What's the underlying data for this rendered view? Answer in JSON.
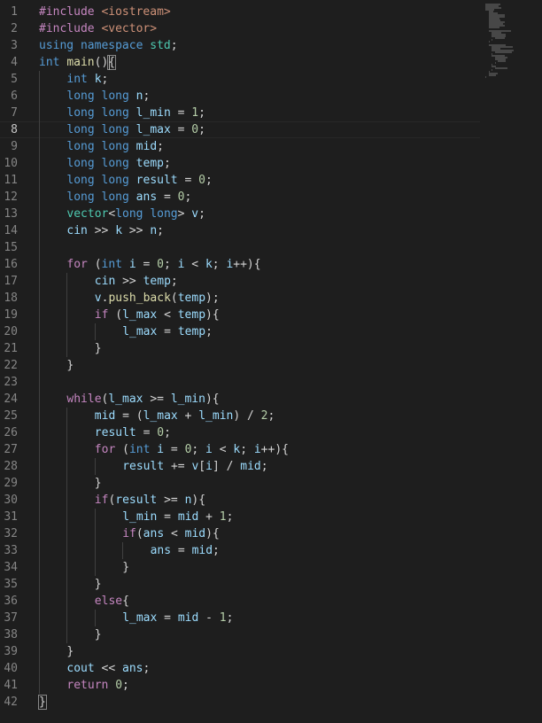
{
  "editor": {
    "current_line": 8,
    "lines": [
      {
        "n": "1",
        "indent": 0,
        "tokens": [
          [
            "#include",
            "pre"
          ],
          [
            " ",
            "punc"
          ],
          [
            "<iostream>",
            "str"
          ]
        ]
      },
      {
        "n": "2",
        "indent": 0,
        "tokens": [
          [
            "#include",
            "pre"
          ],
          [
            " ",
            "punc"
          ],
          [
            "<vector>",
            "str"
          ]
        ]
      },
      {
        "n": "3",
        "indent": 0,
        "tokens": [
          [
            "using",
            "kw"
          ],
          [
            " ",
            "punc"
          ],
          [
            "namespace",
            "kw"
          ],
          [
            " ",
            "punc"
          ],
          [
            "std",
            "type"
          ],
          [
            ";",
            "punc"
          ]
        ]
      },
      {
        "n": "4",
        "indent": 0,
        "tokens": [
          [
            "int",
            "kw"
          ],
          [
            " ",
            "punc"
          ],
          [
            "main",
            "fn"
          ],
          [
            "()",
            "punc"
          ],
          [
            "{",
            "bracket"
          ]
        ]
      },
      {
        "n": "5",
        "indent": 1,
        "tokens": [
          [
            "int",
            "kw"
          ],
          [
            " ",
            "punc"
          ],
          [
            "k",
            "var"
          ],
          [
            ";",
            "punc"
          ]
        ]
      },
      {
        "n": "6",
        "indent": 1,
        "tokens": [
          [
            "long",
            "kw"
          ],
          [
            " ",
            "punc"
          ],
          [
            "long",
            "kw"
          ],
          [
            " ",
            "punc"
          ],
          [
            "n",
            "var"
          ],
          [
            ";",
            "punc"
          ]
        ]
      },
      {
        "n": "7",
        "indent": 1,
        "tokens": [
          [
            "long",
            "kw"
          ],
          [
            " ",
            "punc"
          ],
          [
            "long",
            "kw"
          ],
          [
            " ",
            "punc"
          ],
          [
            "l_min",
            "var"
          ],
          [
            " = ",
            "punc"
          ],
          [
            "1",
            "num"
          ],
          [
            ";",
            "punc"
          ]
        ]
      },
      {
        "n": "8",
        "indent": 1,
        "tokens": [
          [
            "long",
            "kw"
          ],
          [
            " ",
            "punc"
          ],
          [
            "long",
            "kw"
          ],
          [
            " ",
            "punc"
          ],
          [
            "l_max",
            "var"
          ],
          [
            " = ",
            "punc"
          ],
          [
            "0",
            "num"
          ],
          [
            ";",
            "punc"
          ]
        ]
      },
      {
        "n": "9",
        "indent": 1,
        "tokens": [
          [
            "long",
            "kw"
          ],
          [
            " ",
            "punc"
          ],
          [
            "long",
            "kw"
          ],
          [
            " ",
            "punc"
          ],
          [
            "mid",
            "var"
          ],
          [
            ";",
            "punc"
          ]
        ]
      },
      {
        "n": "10",
        "indent": 1,
        "tokens": [
          [
            "long",
            "kw"
          ],
          [
            " ",
            "punc"
          ],
          [
            "long",
            "kw"
          ],
          [
            " ",
            "punc"
          ],
          [
            "temp",
            "var"
          ],
          [
            ";",
            "punc"
          ]
        ]
      },
      {
        "n": "11",
        "indent": 1,
        "tokens": [
          [
            "long",
            "kw"
          ],
          [
            " ",
            "punc"
          ],
          [
            "long",
            "kw"
          ],
          [
            " ",
            "punc"
          ],
          [
            "result",
            "var"
          ],
          [
            " = ",
            "punc"
          ],
          [
            "0",
            "num"
          ],
          [
            ";",
            "punc"
          ]
        ]
      },
      {
        "n": "12",
        "indent": 1,
        "tokens": [
          [
            "long",
            "kw"
          ],
          [
            " ",
            "punc"
          ],
          [
            "long",
            "kw"
          ],
          [
            " ",
            "punc"
          ],
          [
            "ans",
            "var"
          ],
          [
            " = ",
            "punc"
          ],
          [
            "0",
            "num"
          ],
          [
            ";",
            "punc"
          ]
        ]
      },
      {
        "n": "13",
        "indent": 1,
        "tokens": [
          [
            "vector",
            "type"
          ],
          [
            "<",
            "punc"
          ],
          [
            "long",
            "kw"
          ],
          [
            " ",
            "punc"
          ],
          [
            "long",
            "kw"
          ],
          [
            "> ",
            "punc"
          ],
          [
            "v",
            "var"
          ],
          [
            ";",
            "punc"
          ]
        ]
      },
      {
        "n": "14",
        "indent": 1,
        "tokens": [
          [
            "cin",
            "var"
          ],
          [
            " >> ",
            "punc"
          ],
          [
            "k",
            "var"
          ],
          [
            " >> ",
            "punc"
          ],
          [
            "n",
            "var"
          ],
          [
            ";",
            "punc"
          ]
        ]
      },
      {
        "n": "15",
        "indent": 1,
        "tokens": []
      },
      {
        "n": "16",
        "indent": 1,
        "tokens": [
          [
            "for",
            "ctrl"
          ],
          [
            " (",
            "punc"
          ],
          [
            "int",
            "kw"
          ],
          [
            " ",
            "punc"
          ],
          [
            "i",
            "var"
          ],
          [
            " = ",
            "punc"
          ],
          [
            "0",
            "num"
          ],
          [
            "; ",
            "punc"
          ],
          [
            "i",
            "var"
          ],
          [
            " < ",
            "punc"
          ],
          [
            "k",
            "var"
          ],
          [
            "; ",
            "punc"
          ],
          [
            "i",
            "var"
          ],
          [
            "++){",
            "punc"
          ]
        ]
      },
      {
        "n": "17",
        "indent": 2,
        "tokens": [
          [
            "cin",
            "var"
          ],
          [
            " >> ",
            "punc"
          ],
          [
            "temp",
            "var"
          ],
          [
            ";",
            "punc"
          ]
        ]
      },
      {
        "n": "18",
        "indent": 2,
        "tokens": [
          [
            "v",
            "var"
          ],
          [
            ".",
            "punc"
          ],
          [
            "push_back",
            "fn"
          ],
          [
            "(",
            "punc"
          ],
          [
            "temp",
            "var"
          ],
          [
            ");",
            "punc"
          ]
        ]
      },
      {
        "n": "19",
        "indent": 2,
        "tokens": [
          [
            "if",
            "ctrl"
          ],
          [
            " (",
            "punc"
          ],
          [
            "l_max",
            "var"
          ],
          [
            " < ",
            "punc"
          ],
          [
            "temp",
            "var"
          ],
          [
            "){",
            "punc"
          ]
        ]
      },
      {
        "n": "20",
        "indent": 3,
        "tokens": [
          [
            "l_max",
            "var"
          ],
          [
            " = ",
            "punc"
          ],
          [
            "temp",
            "var"
          ],
          [
            ";",
            "punc"
          ]
        ]
      },
      {
        "n": "21",
        "indent": 2,
        "tokens": [
          [
            "}",
            "punc"
          ]
        ]
      },
      {
        "n": "22",
        "indent": 1,
        "tokens": [
          [
            "}",
            "punc"
          ]
        ]
      },
      {
        "n": "23",
        "indent": 1,
        "tokens": []
      },
      {
        "n": "24",
        "indent": 1,
        "tokens": [
          [
            "while",
            "ctrl"
          ],
          [
            "(",
            "punc"
          ],
          [
            "l_max",
            "var"
          ],
          [
            " >= ",
            "punc"
          ],
          [
            "l_min",
            "var"
          ],
          [
            "){",
            "punc"
          ]
        ]
      },
      {
        "n": "25",
        "indent": 2,
        "tokens": [
          [
            "mid",
            "var"
          ],
          [
            " = (",
            "punc"
          ],
          [
            "l_max",
            "var"
          ],
          [
            " + ",
            "punc"
          ],
          [
            "l_min",
            "var"
          ],
          [
            ") / ",
            "punc"
          ],
          [
            "2",
            "num"
          ],
          [
            ";",
            "punc"
          ]
        ]
      },
      {
        "n": "26",
        "indent": 2,
        "tokens": [
          [
            "result",
            "var"
          ],
          [
            " = ",
            "punc"
          ],
          [
            "0",
            "num"
          ],
          [
            ";",
            "punc"
          ]
        ]
      },
      {
        "n": "27",
        "indent": 2,
        "tokens": [
          [
            "for",
            "ctrl"
          ],
          [
            " (",
            "punc"
          ],
          [
            "int",
            "kw"
          ],
          [
            " ",
            "punc"
          ],
          [
            "i",
            "var"
          ],
          [
            " = ",
            "punc"
          ],
          [
            "0",
            "num"
          ],
          [
            "; ",
            "punc"
          ],
          [
            "i",
            "var"
          ],
          [
            " < ",
            "punc"
          ],
          [
            "k",
            "var"
          ],
          [
            "; ",
            "punc"
          ],
          [
            "i",
            "var"
          ],
          [
            "++){",
            "punc"
          ]
        ]
      },
      {
        "n": "28",
        "indent": 3,
        "tokens": [
          [
            "result",
            "var"
          ],
          [
            " += ",
            "punc"
          ],
          [
            "v",
            "var"
          ],
          [
            "[",
            "punc"
          ],
          [
            "i",
            "var"
          ],
          [
            "] / ",
            "punc"
          ],
          [
            "mid",
            "var"
          ],
          [
            ";",
            "punc"
          ]
        ]
      },
      {
        "n": "29",
        "indent": 2,
        "tokens": [
          [
            "}",
            "punc"
          ]
        ]
      },
      {
        "n": "30",
        "indent": 2,
        "tokens": [
          [
            "if",
            "ctrl"
          ],
          [
            "(",
            "punc"
          ],
          [
            "result",
            "var"
          ],
          [
            " >= ",
            "punc"
          ],
          [
            "n",
            "var"
          ],
          [
            "){",
            "punc"
          ]
        ]
      },
      {
        "n": "31",
        "indent": 3,
        "tokens": [
          [
            "l_min",
            "var"
          ],
          [
            " = ",
            "punc"
          ],
          [
            "mid",
            "var"
          ],
          [
            " + ",
            "punc"
          ],
          [
            "1",
            "num"
          ],
          [
            ";",
            "punc"
          ]
        ]
      },
      {
        "n": "32",
        "indent": 3,
        "tokens": [
          [
            "if",
            "ctrl"
          ],
          [
            "(",
            "punc"
          ],
          [
            "ans",
            "var"
          ],
          [
            " < ",
            "punc"
          ],
          [
            "mid",
            "var"
          ],
          [
            "){",
            "punc"
          ]
        ]
      },
      {
        "n": "33",
        "indent": 4,
        "tokens": [
          [
            "ans",
            "var"
          ],
          [
            " = ",
            "punc"
          ],
          [
            "mid",
            "var"
          ],
          [
            ";",
            "punc"
          ]
        ]
      },
      {
        "n": "34",
        "indent": 3,
        "tokens": [
          [
            "}",
            "punc"
          ]
        ]
      },
      {
        "n": "35",
        "indent": 2,
        "tokens": [
          [
            "}",
            "punc"
          ]
        ]
      },
      {
        "n": "36",
        "indent": 2,
        "tokens": [
          [
            "else",
            "ctrl"
          ],
          [
            "{",
            "punc"
          ]
        ]
      },
      {
        "n": "37",
        "indent": 3,
        "tokens": [
          [
            "l_max",
            "var"
          ],
          [
            " = ",
            "punc"
          ],
          [
            "mid",
            "var"
          ],
          [
            " - ",
            "punc"
          ],
          [
            "1",
            "num"
          ],
          [
            ";",
            "punc"
          ]
        ]
      },
      {
        "n": "38",
        "indent": 2,
        "tokens": [
          [
            "}",
            "punc"
          ]
        ]
      },
      {
        "n": "39",
        "indent": 1,
        "tokens": [
          [
            "}",
            "punc"
          ]
        ]
      },
      {
        "n": "40",
        "indent": 1,
        "tokens": [
          [
            "cout",
            "var"
          ],
          [
            " << ",
            "punc"
          ],
          [
            "ans",
            "var"
          ],
          [
            ";",
            "punc"
          ]
        ]
      },
      {
        "n": "41",
        "indent": 1,
        "tokens": [
          [
            "return",
            "ctrl"
          ],
          [
            " ",
            "punc"
          ],
          [
            "0",
            "num"
          ],
          [
            ";",
            "punc"
          ]
        ]
      },
      {
        "n": "42",
        "indent": 0,
        "tokens": [
          [
            "}",
            "bracket"
          ]
        ]
      }
    ]
  },
  "theme": {
    "background": "#1e1e1e",
    "keyword": "#569cd6",
    "control": "#c586c0",
    "type": "#4ec9b0",
    "function": "#dcdcaa",
    "variable": "#9cdcfe",
    "number": "#b5cea8",
    "string": "#ce9178"
  }
}
